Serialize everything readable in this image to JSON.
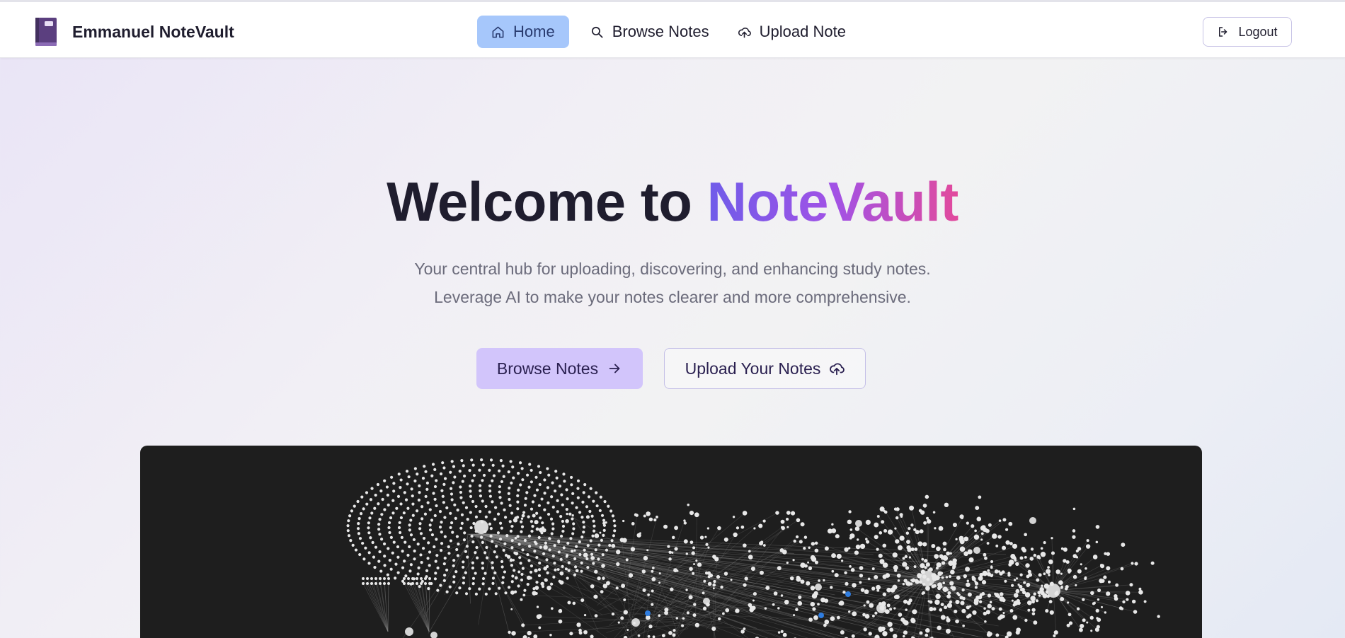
{
  "header": {
    "brand_name": "Emmanuel NoteVault",
    "logo_icon": "book-icon",
    "nav": [
      {
        "label": "Home",
        "icon": "home-icon",
        "active": true
      },
      {
        "label": "Browse Notes",
        "icon": "search-icon",
        "active": false
      },
      {
        "label": "Upload Note",
        "icon": "cloud-upload-icon",
        "active": false
      }
    ],
    "logout_label": "Logout",
    "logout_icon": "logout-icon"
  },
  "hero": {
    "title_prefix": "Welcome to",
    "title_highlight": "NoteVault",
    "subtitle_line1": "Your central hub for uploading, discovering, and enhancing study notes.",
    "subtitle_line2": "Leverage AI to make your notes clearer and more comprehensive.",
    "primary_cta": "Browse Notes",
    "primary_cta_icon": "arrow-right-icon",
    "secondary_cta": "Upload Your Notes",
    "secondary_cta_icon": "cloud-upload-icon"
  },
  "graph_preview": {
    "icon": "knowledge-graph-visualization"
  },
  "colors": {
    "accent_active_nav": "#a6c7fb",
    "primary_cta_bg": "#d2c5fb",
    "gradient_start": "#6f5ce9",
    "gradient_end": "#e24a9c",
    "graph_bg": "#1e1e1e"
  }
}
